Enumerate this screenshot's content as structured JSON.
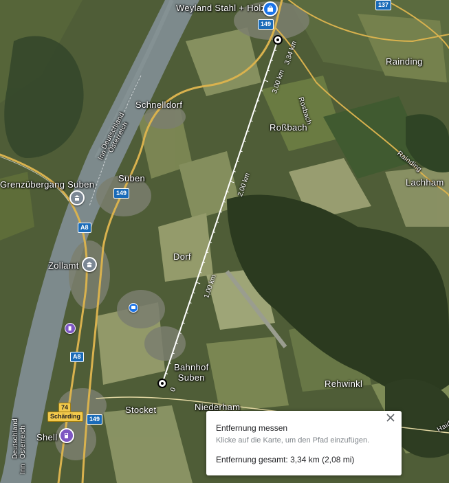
{
  "map": {
    "places": {
      "weyland": "Weyland Stahl + Holz",
      "raindingTop": "Rainding",
      "schnelldorf": "Schnelldorf",
      "rossbach": "Roßbach",
      "grenz": "Grenzübergang Suben",
      "suben": "Suben",
      "lachham": "Lachham",
      "zollamt": "Zollamt",
      "dorf": "Dorf",
      "bahnhofSuben": "Bahnhof\nSuben",
      "rehwinkl": "Rehwinkl",
      "stocket": "Stocket",
      "niederham": "Niederham",
      "shell": "Shell",
      "schaerding": "Schärding"
    },
    "road_labels": {
      "rosbach": "Rosbach",
      "rainding": "Rainding",
      "haid": "Haid"
    },
    "border_labels": {
      "top": [
        "Deutschland",
        "Österreich"
      ],
      "bottom": [
        "Deutschland",
        "Österreich"
      ]
    },
    "river_labels": [
      "Inn",
      "Inn"
    ],
    "shields": {
      "r149a": "149",
      "r149b": "149",
      "r149c": "149",
      "r137": "137",
      "a8a": "A8",
      "a8b": "A8",
      "r74": "74"
    },
    "measure_labels": {
      "start": "0",
      "km1": "1,00 km",
      "km2": "2,00 km",
      "km3": "3,00 km",
      "end": "3,34 km"
    }
  },
  "measure_card": {
    "title": "Entfernung messen",
    "hint": "Klicke auf die Karte, um den Pfad einzufügen.",
    "total": "Entfernung gesamt: 3,34 km (2,08 mi)"
  }
}
